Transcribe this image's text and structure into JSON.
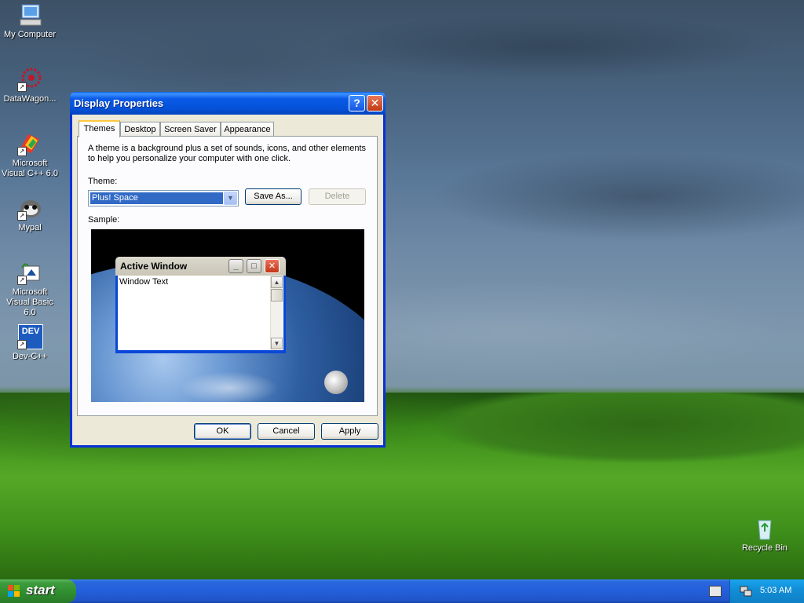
{
  "desktop": {
    "icons": [
      {
        "label": "My Computer",
        "icon": "my-computer-icon"
      },
      {
        "label": "DataWagon...",
        "icon": "datawagon-icon"
      },
      {
        "label": "Microsoft Visual C++ 6.0",
        "icon": "visual-cpp-icon"
      },
      {
        "label": "Mypal",
        "icon": "mypal-icon"
      },
      {
        "label": "Microsoft Visual Basic 6.0",
        "icon": "visual-basic-icon"
      },
      {
        "label": "Dev-C++",
        "icon": "dev-cpp-icon"
      },
      {
        "label": "Recycle Bin",
        "icon": "recycle-bin-icon"
      }
    ],
    "dev_icon_text": "DEV"
  },
  "dialog": {
    "title": "Display Properties",
    "help_glyph": "?",
    "close_glyph": "✕",
    "tabs": [
      "Themes",
      "Desktop",
      "Screen Saver",
      "Appearance"
    ],
    "active_tab": "Themes",
    "description": "A theme is a background plus a set of sounds, icons, and other elements to help you personalize your computer with one click.",
    "theme_label": "Theme:",
    "theme_value": "Plus! Space",
    "save_as_label": "Save As...",
    "delete_label": "Delete",
    "sample_label": "Sample:",
    "sample_window": {
      "title": "Active Window",
      "body_text": "Window Text"
    },
    "ok_label": "OK",
    "cancel_label": "Cancel",
    "apply_label": "Apply"
  },
  "taskbar": {
    "start_label": "start",
    "clock": "5:03 AM"
  },
  "colors": {
    "title_bar": "#0553d9",
    "selection": "#316ac5",
    "start_green": "#2e8c2e",
    "taskbar_blue": "#245edb"
  }
}
